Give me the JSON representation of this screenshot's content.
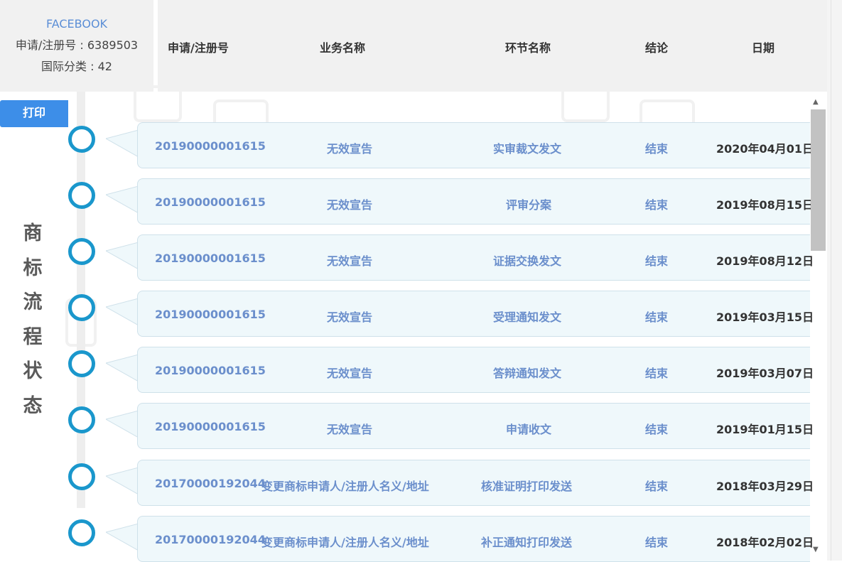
{
  "info": {
    "brand": "FACEBOOK",
    "reg_no": "申请/注册号 : 6389503",
    "intl_class": "国际分类 : 42"
  },
  "header": {
    "col_no": "申请/注册号",
    "col_business": "业务名称",
    "col_step": "环节名称",
    "col_result": "结论",
    "col_date": "日期"
  },
  "print_label": "打印",
  "vertical_title": "商标流程状态",
  "rows": [
    {
      "no": "20190000001615",
      "business": "无效宣告",
      "step": "实审裁文发文",
      "result": "结束",
      "date": "2020年04月01日"
    },
    {
      "no": "20190000001615",
      "business": "无效宣告",
      "step": "评审分案",
      "result": "结束",
      "date": "2019年08月15日"
    },
    {
      "no": "20190000001615",
      "business": "无效宣告",
      "step": "证据交换发文",
      "result": "结束",
      "date": "2019年08月12日"
    },
    {
      "no": "20190000001615",
      "business": "无效宣告",
      "step": "受理通知发文",
      "result": "结束",
      "date": "2019年03月15日"
    },
    {
      "no": "20190000001615",
      "business": "无效宣告",
      "step": "答辩通知发文",
      "result": "结束",
      "date": "2019年03月07日"
    },
    {
      "no": "20190000001615",
      "business": "无效宣告",
      "step": "申请收文",
      "result": "结束",
      "date": "2019年01月15日"
    },
    {
      "no": "20170000192044",
      "business": "变更商标申请人/注册人名义/地址",
      "step": "核准证明打印发送",
      "result": "结束",
      "date": "2018年03月29日"
    },
    {
      "no": "20170000192044",
      "business": "变更商标申请人/注册人名义/地址",
      "step": "补正通知打印发送",
      "result": "结束",
      "date": "2018年02月02日"
    }
  ],
  "icons": {
    "node": "circle-node-icon",
    "scroll_up": "triangle-up-icon",
    "scroll_down": "triangle-down-icon"
  },
  "colors": {
    "accent": "#1a97cc",
    "button": "#3d8ee8",
    "link_text": "#6b8fcc",
    "row_bg": "#eff8fb"
  }
}
